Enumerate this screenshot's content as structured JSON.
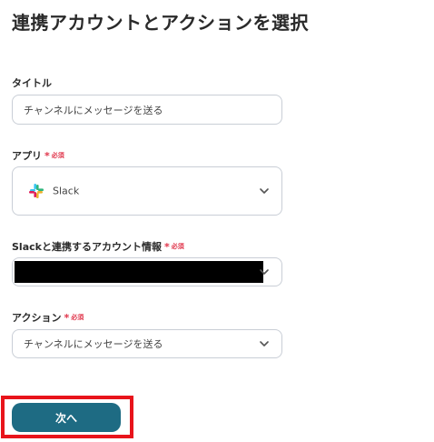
{
  "page": {
    "title": "連携アカウントとアクションを選択"
  },
  "form": {
    "title_field": {
      "label": "タイトル",
      "value": "チャンネルにメッセージを送る"
    },
    "app_field": {
      "label": "アプリ",
      "required_mark": "*",
      "required_text": "必須",
      "value": "Slack",
      "icon": "slack-logo-icon"
    },
    "account_field": {
      "label": "Slackと連携するアカウント情報",
      "required_mark": "*",
      "required_text": "必須",
      "value_redacted": true
    },
    "action_field": {
      "label": "アクション",
      "required_mark": "*",
      "required_text": "必須",
      "value": "チャンネルにメッセージを送る"
    }
  },
  "footer": {
    "next_label": "次へ",
    "highlight_color": "#e8141b"
  },
  "colors": {
    "primary_button": "#1e6b83",
    "required": "#e0344a",
    "border": "#c9ced6"
  }
}
